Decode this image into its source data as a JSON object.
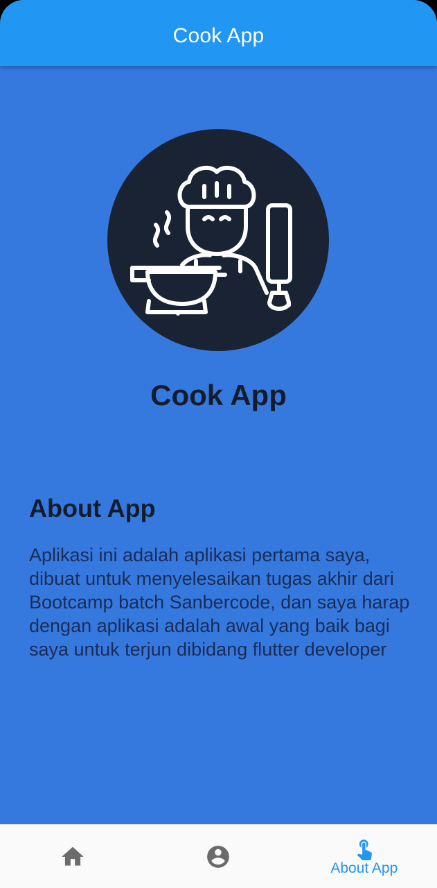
{
  "appbar": {
    "title": "Cook App"
  },
  "profile": {
    "logo_icon": "chef-cooking-icon",
    "app_name": "Cook App"
  },
  "about": {
    "heading": "About App",
    "text": "Aplikasi ini adalah aplikasi pertama saya, dibuat untuk menyelesaikan tugas akhir dari Bootcamp batch Sanbercode, dan saya harap dengan aplikasi adalah awal yang baik bagi saya untuk terjun dibidang flutter developer"
  },
  "bottom_nav": {
    "items": [
      {
        "icon": "home-icon",
        "label": ""
      },
      {
        "icon": "account-circle-icon",
        "label": ""
      },
      {
        "icon": "touch-app-icon",
        "label": "About App",
        "selected": true
      }
    ]
  },
  "colors": {
    "appbar": "#2196f3",
    "background": "#3579de",
    "logo_circle": "#1a2333",
    "nav_selected": "#2196f3",
    "nav_unselected": "#6b6b6b"
  }
}
